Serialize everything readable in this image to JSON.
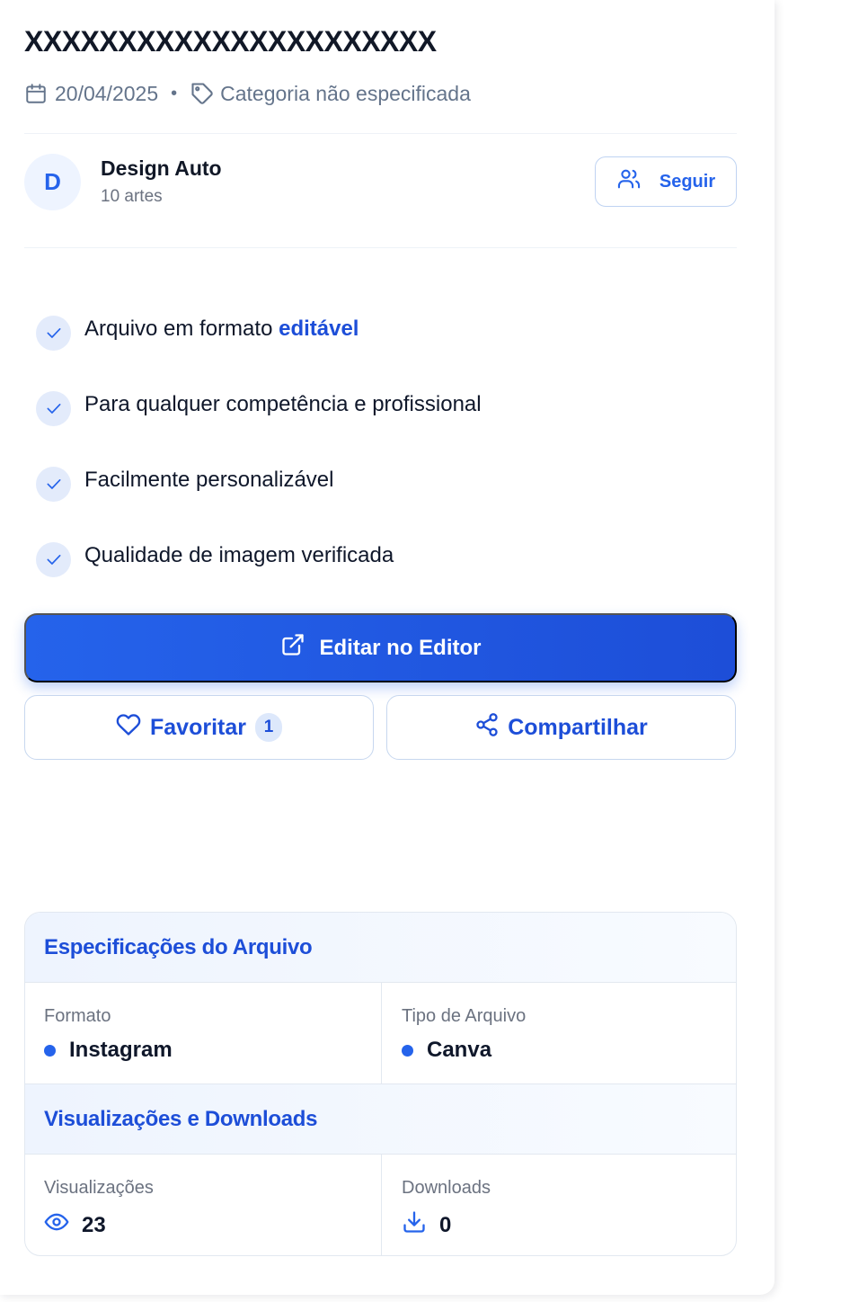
{
  "title": "XXXXXXXXXXXXXXXXXXXXXX",
  "meta": {
    "date": "20/04/2025",
    "separator": "•",
    "category": "Categoria não especificada"
  },
  "author": {
    "initial": "D",
    "name": "Design Auto",
    "count": "10 artes",
    "follow_label": "Seguir"
  },
  "features": [
    {
      "text": "Arquivo em formato ",
      "highlight": "editável"
    },
    {
      "text": "Para qualquer competência e profissional",
      "highlight": ""
    },
    {
      "text": "Facilmente personalizável",
      "highlight": ""
    },
    {
      "text": "Qualidade de imagem verificada",
      "highlight": ""
    }
  ],
  "actions": {
    "edit_label": "Editar no Editor",
    "favorite_label": "Favoritar",
    "favorite_count": "1",
    "share_label": "Compartilhar"
  },
  "specs": {
    "file_section_title": "Especificações do Arquivo",
    "format_label": "Formato",
    "format_value": "Instagram",
    "type_label": "Tipo de Arquivo",
    "type_value": "Canva",
    "stats_section_title": "Visualizações e Downloads",
    "views_label": "Visualizações",
    "views_value": "23",
    "downloads_label": "Downloads",
    "downloads_value": "0"
  },
  "colors": {
    "accent": "#2563eb",
    "accent_dark": "#1d4ed8",
    "text": "#0f172a",
    "muted": "#6b7280"
  },
  "icons": {
    "date": "calendar-icon",
    "category": "tag-icon",
    "follow": "users-icon",
    "feature": "check-icon",
    "edit": "external-link-icon",
    "favorite": "heart-icon",
    "share": "share-icon",
    "views": "eye-icon",
    "downloads": "download-icon"
  }
}
